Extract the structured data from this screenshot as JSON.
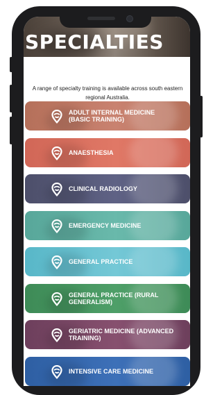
{
  "page": {
    "title": "SPECIALTIES",
    "intro": "A range of specialty training is available across south eastern regional Australia."
  },
  "icons": {
    "card_icon": "location-pin-icon"
  },
  "specialties": [
    {
      "label": "ADULT INTERNAL MEDICINE\n(BASIC TRAINING)",
      "color": "#b5705a",
      "color2": "#c98270"
    },
    {
      "label": "ANAESTHESIA",
      "color": "#d16757",
      "color2": "#e07866"
    },
    {
      "label": "CLINICAL RADIOLOGY",
      "color": "#4d4f6a",
      "color2": "#5f6285"
    },
    {
      "label": "EMERGENCY MEDICINE",
      "color": "#58a79a",
      "color2": "#69b9ab"
    },
    {
      "label": "GENERAL PRACTICE",
      "color": "#58b7c8",
      "color2": "#74c8d6"
    },
    {
      "label": "GENERAL PRACTICE (RURAL\nGENERALISM)",
      "color": "#3e8b57",
      "color2": "#4e9f68"
    },
    {
      "label": "GERIATRIC MEDICINE (ADVANCED\nTRAINING)",
      "color": "#6d3f5c",
      "color2": "#87506f"
    },
    {
      "label": "INTENSIVE CARE MEDICINE",
      "color": "#2e5fa3",
      "color2": "#3d70b8"
    }
  ]
}
